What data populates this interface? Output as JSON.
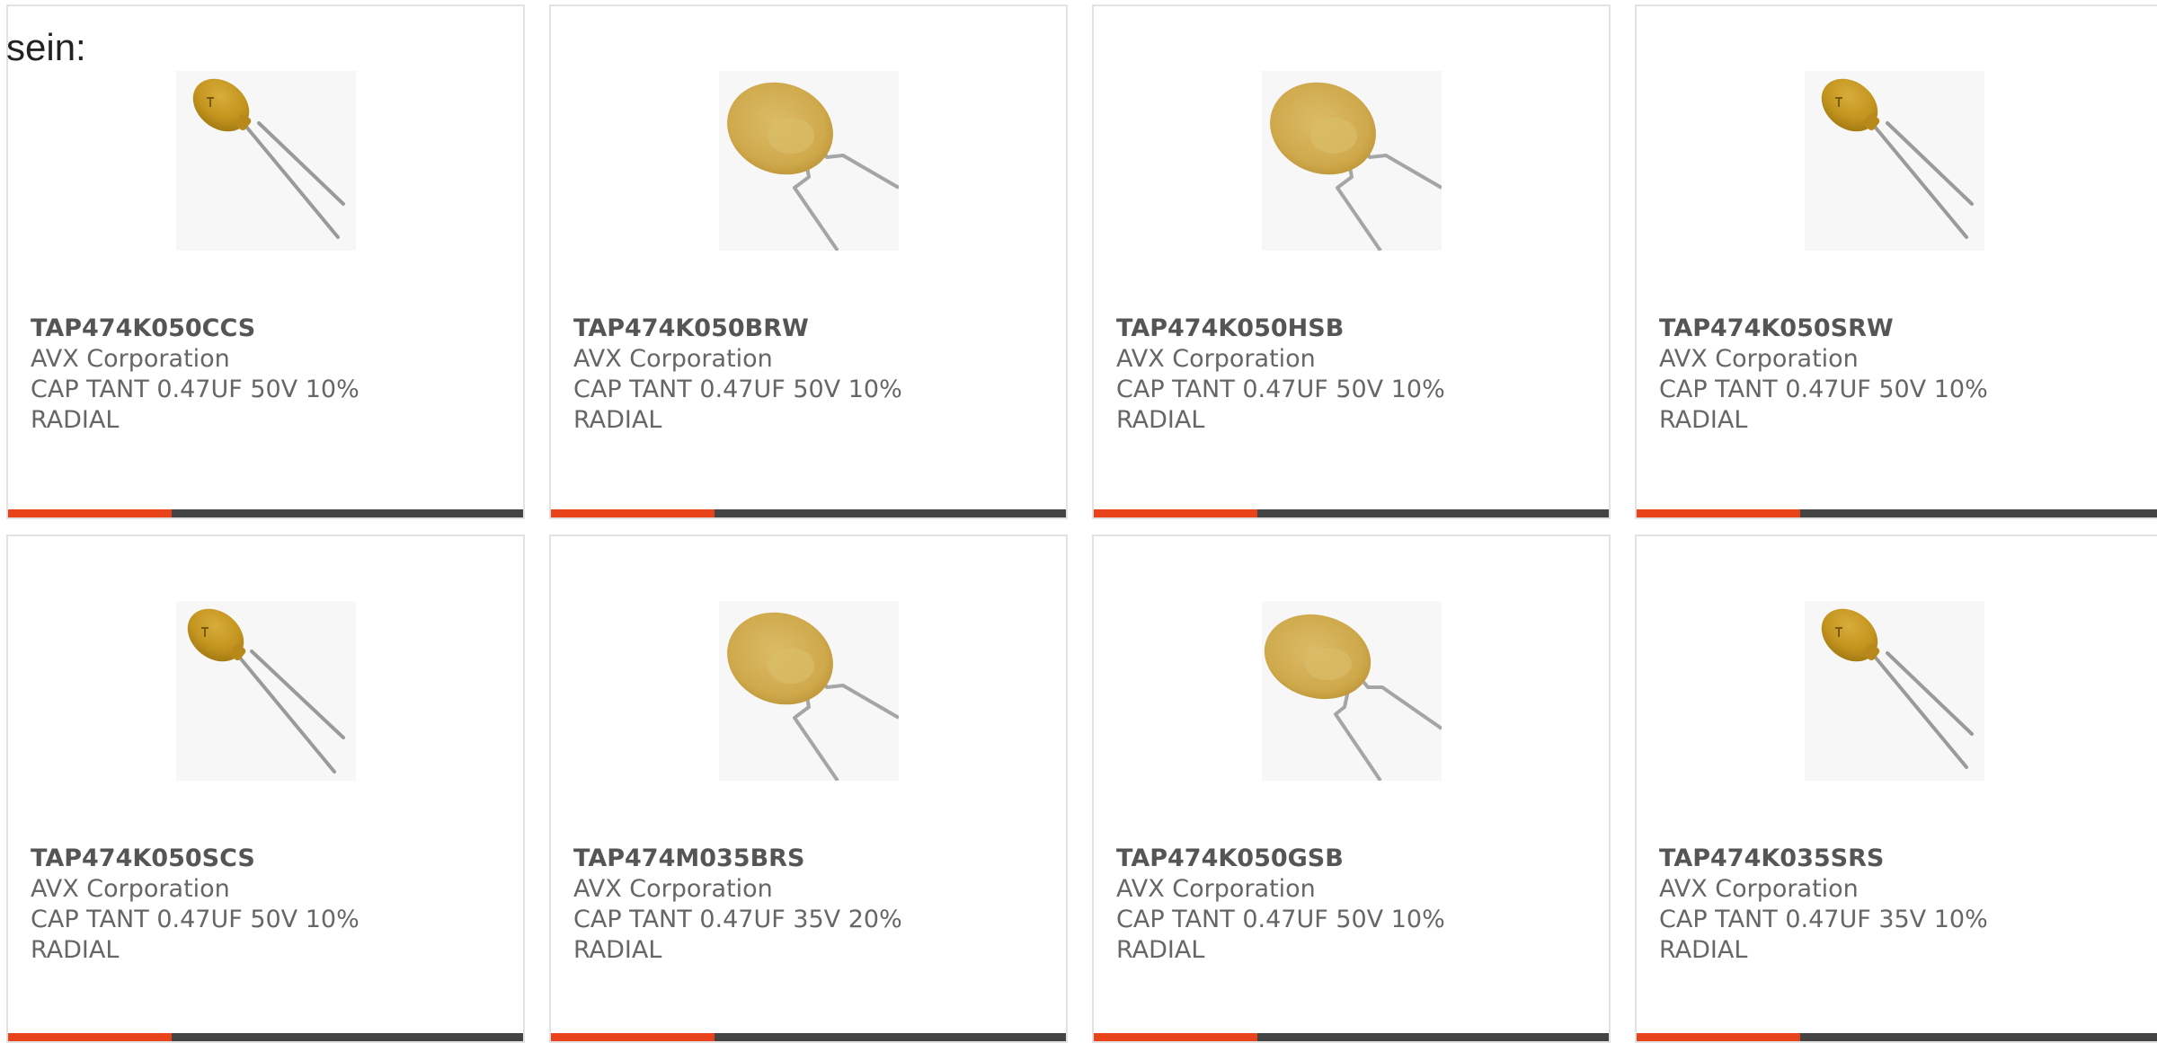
{
  "lead_text": "sein:",
  "colors": {
    "accent": "#e8431a",
    "bar": "#444444",
    "border": "#e2e2e2",
    "text": "#666666"
  },
  "products": [
    {
      "part_number": "TAP474K050CCS",
      "manufacturer": "AVX Corporation",
      "description_line1": "CAP TANT 0.47UF 50V 10%",
      "description_line2": "RADIAL",
      "image": "small-tantalum-capacitor-icon"
    },
    {
      "part_number": "TAP474K050BRW",
      "manufacturer": "AVX Corporation",
      "description_line1": "CAP TANT 0.47UF 50V 10%",
      "description_line2": "RADIAL",
      "image": "disc-tantalum-capacitor-icon"
    },
    {
      "part_number": "TAP474K050HSB",
      "manufacturer": "AVX Corporation",
      "description_line1": "CAP TANT 0.47UF 50V 10%",
      "description_line2": "RADIAL",
      "image": "disc-tantalum-capacitor-icon"
    },
    {
      "part_number": "TAP474K050SRW",
      "manufacturer": "AVX Corporation",
      "description_line1": "CAP TANT 0.47UF 50V 10%",
      "description_line2": "RADIAL",
      "image": "small-tantalum-capacitor-icon"
    },
    {
      "part_number": "TAP474K050SCS",
      "manufacturer": "AVX Corporation",
      "description_line1": "CAP TANT 0.47UF 50V 10%",
      "description_line2": "RADIAL",
      "image": "small-tantalum-capacitor-icon"
    },
    {
      "part_number": "TAP474M035BRS",
      "manufacturer": "AVX Corporation",
      "description_line1": "CAP TANT 0.47UF 35V 20%",
      "description_line2": "RADIAL",
      "image": "disc-tantalum-capacitor-icon"
    },
    {
      "part_number": "TAP474K050GSB",
      "manufacturer": "AVX Corporation",
      "description_line1": "CAP TANT 0.47UF 50V 10%",
      "description_line2": "RADIAL",
      "image": "disc-tantalum-capacitor-icon"
    },
    {
      "part_number": "TAP474K035SRS",
      "manufacturer": "AVX Corporation",
      "description_line1": "CAP TANT 0.47UF 35V 10%",
      "description_line2": "RADIAL",
      "image": "small-tantalum-capacitor-icon"
    }
  ]
}
